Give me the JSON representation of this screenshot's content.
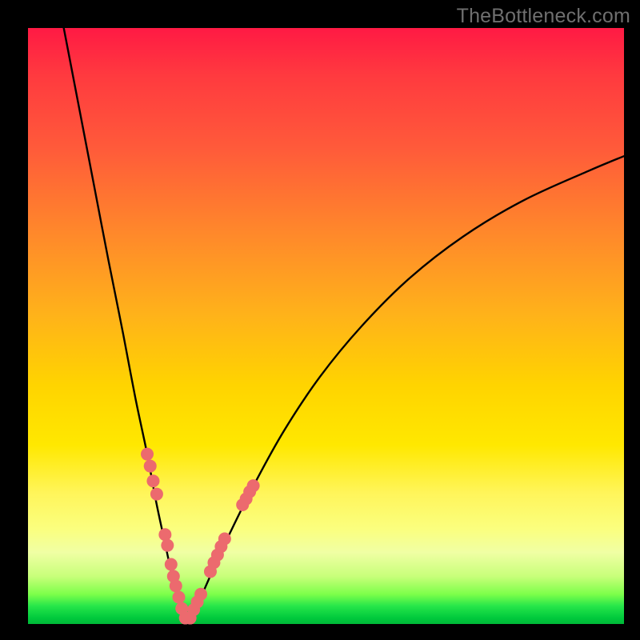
{
  "watermark": {
    "text": "TheBottleneck.com"
  },
  "chart_data": {
    "type": "line",
    "title": "",
    "xlabel": "",
    "ylabel": "",
    "xlim": [
      0,
      100
    ],
    "ylim": [
      0,
      100
    ],
    "grid": false,
    "legend": false,
    "background_gradient": {
      "direction": "vertical",
      "stops": [
        {
          "pos": 0.0,
          "color": "#ff1a44"
        },
        {
          "pos": 0.35,
          "color": "#ff8a2a"
        },
        {
          "pos": 0.6,
          "color": "#ffd400"
        },
        {
          "pos": 0.84,
          "color": "#fbff7e"
        },
        {
          "pos": 0.95,
          "color": "#7dff4a"
        },
        {
          "pos": 1.0,
          "color": "#00b838"
        }
      ]
    },
    "series": [
      {
        "name": "bottleneck_curve_left",
        "color": "#000000",
        "x": [
          6.0,
          8.5,
          11.0,
          13.5,
          16.0,
          18.0,
          20.0,
          21.5,
          23.0,
          24.2,
          25.2,
          26.0,
          26.6
        ],
        "y": [
          100.0,
          87.0,
          74.0,
          61.0,
          48.5,
          38.0,
          28.5,
          20.5,
          13.5,
          8.0,
          4.0,
          1.4,
          0.0
        ]
      },
      {
        "name": "bottleneck_curve_right",
        "color": "#000000",
        "x": [
          26.6,
          27.5,
          29.0,
          31.0,
          34.0,
          38.0,
          43.0,
          49.0,
          56.0,
          64.0,
          73.0,
          83.0,
          94.0,
          100.0
        ],
        "y": [
          0.0,
          1.5,
          4.5,
          9.0,
          15.5,
          23.5,
          32.5,
          41.5,
          50.0,
          58.0,
          65.0,
          71.0,
          76.0,
          78.5
        ]
      }
    ],
    "scatter": [
      {
        "name": "left_branch_points",
        "color": "#ec6a6e",
        "radius_px": 8,
        "points": [
          {
            "x": 20.0,
            "y": 28.5
          },
          {
            "x": 20.5,
            "y": 26.5
          },
          {
            "x": 21.0,
            "y": 24.0
          },
          {
            "x": 21.6,
            "y": 21.8
          },
          {
            "x": 23.0,
            "y": 15.0
          },
          {
            "x": 23.4,
            "y": 13.2
          },
          {
            "x": 24.0,
            "y": 10.0
          },
          {
            "x": 24.4,
            "y": 8.0
          },
          {
            "x": 24.8,
            "y": 6.4
          },
          {
            "x": 25.3,
            "y": 4.5
          },
          {
            "x": 25.8,
            "y": 2.6
          },
          {
            "x": 26.4,
            "y": 1.0
          }
        ]
      },
      {
        "name": "right_branch_points",
        "color": "#ec6a6e",
        "radius_px": 8,
        "points": [
          {
            "x": 27.2,
            "y": 1.0
          },
          {
            "x": 27.8,
            "y": 2.4
          },
          {
            "x": 28.4,
            "y": 3.7
          },
          {
            "x": 29.0,
            "y": 5.0
          },
          {
            "x": 30.6,
            "y": 8.8
          },
          {
            "x": 31.2,
            "y": 10.3
          },
          {
            "x": 31.8,
            "y": 11.6
          },
          {
            "x": 32.4,
            "y": 13.0
          },
          {
            "x": 33.0,
            "y": 14.3
          },
          {
            "x": 36.0,
            "y": 20.0
          },
          {
            "x": 36.6,
            "y": 21.0
          },
          {
            "x": 37.2,
            "y": 22.2
          },
          {
            "x": 37.8,
            "y": 23.2
          }
        ]
      }
    ]
  }
}
